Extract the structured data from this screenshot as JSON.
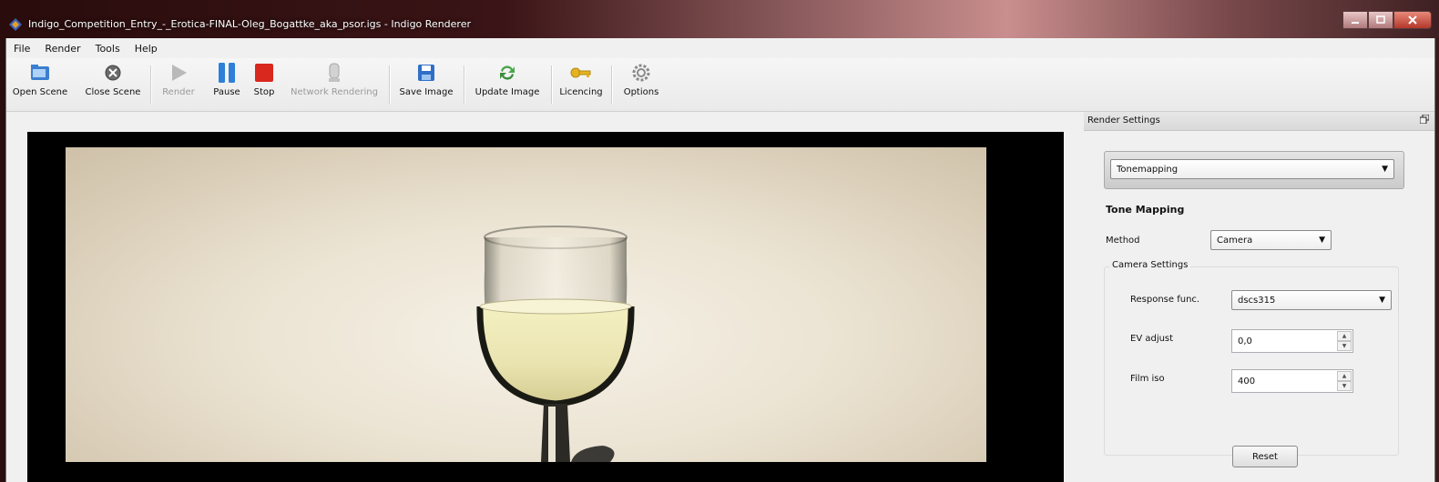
{
  "window": {
    "title": "Indigo_Competition_Entry_-_Erotica-FINAL-Oleg_Bogattke_aka_psor.igs - Indigo Renderer",
    "controls": [
      "minimize",
      "maximize",
      "close"
    ]
  },
  "menu": {
    "items": [
      "File",
      "Render",
      "Tools",
      "Help"
    ]
  },
  "toolbar": {
    "buttons": [
      {
        "label": "Open Scene",
        "icon": "open-folder-icon",
        "enabled": true
      },
      {
        "label": "Close Scene",
        "icon": "close-circle-icon",
        "enabled": true
      },
      {
        "label": "Render",
        "icon": "play-icon",
        "enabled": false
      },
      {
        "label": "Pause",
        "icon": "pause-icon",
        "enabled": true
      },
      {
        "label": "Stop",
        "icon": "stop-icon",
        "enabled": true
      },
      {
        "label": "Network Rendering",
        "icon": "network-icon",
        "enabled": false
      },
      {
        "label": "Save Image",
        "icon": "save-icon",
        "enabled": true
      },
      {
        "label": "Update Image",
        "icon": "refresh-icon",
        "enabled": true
      },
      {
        "label": "Licencing",
        "icon": "key-icon",
        "enabled": true
      },
      {
        "label": "Options",
        "icon": "gear-icon",
        "enabled": true
      }
    ]
  },
  "panel": {
    "title": "Render Settings",
    "section_selector": "Tonemapping",
    "section_heading": "Tone Mapping",
    "method_label": "Method",
    "method_value": "Camera",
    "camera_group_title": "Camera Settings",
    "response_label": "Response func.",
    "response_value": "dscs315",
    "ev_label": "EV adjust",
    "ev_value": "0,0",
    "iso_label": "Film iso",
    "iso_value": "400",
    "reset_label": "Reset"
  },
  "colors": {
    "stop_red": "#d9281e",
    "pause_blue": "#2f7fd8",
    "play_gray": "#a8a8a8",
    "refresh_green": "#4aa64a",
    "key_yellow": "#e5b321"
  }
}
